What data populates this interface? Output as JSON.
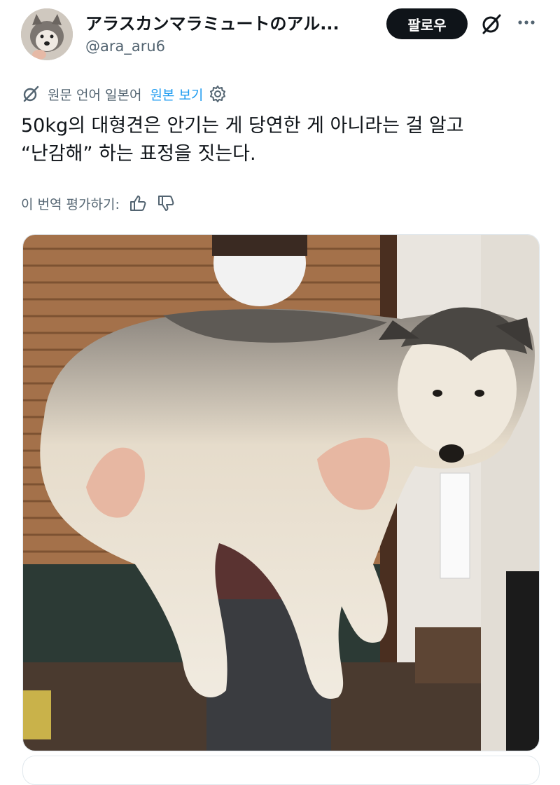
{
  "header": {
    "display_name": "アラスカンマラミュートのアル...",
    "handle": "@ara_aru6",
    "follow_label": "팔로우"
  },
  "translation": {
    "source_language": "원문 언어 일본어",
    "view_original": "원본 보기"
  },
  "tweet": {
    "lines": [
      "50kg의 대형견은 안기는 게 당연한 게 아니라는 걸 알고",
      "“난감해” 하는 표정을 짓는다."
    ]
  },
  "rating": {
    "label": "이 번역 평가하기:"
  },
  "icons": {
    "grok": "grok-icon",
    "more": "more-icon",
    "settings": "gear-icon",
    "like": "thumbs-up-icon",
    "dislike": "thumbs-down-icon"
  },
  "colors": {
    "link": "#1d9bf0",
    "secondary_text": "#536471",
    "follow_bg": "#0f1419"
  }
}
